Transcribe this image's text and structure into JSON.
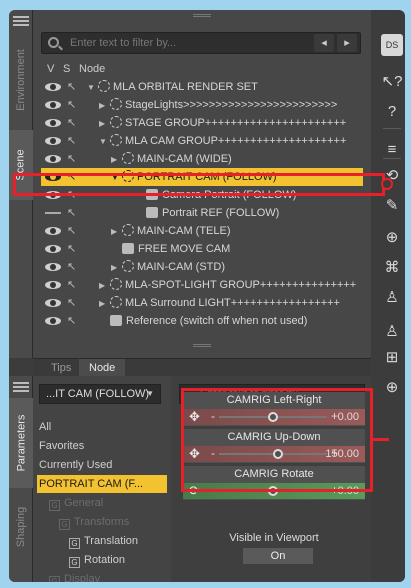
{
  "scene_panel": {
    "vertical_tabs": [
      {
        "label": "Environment",
        "active": false
      },
      {
        "label": "Scene",
        "active": true
      }
    ],
    "search": {
      "placeholder": "Enter text to filter by..."
    },
    "nav": {
      "prev": "◂",
      "next": "▸"
    },
    "columns": {
      "v": "V",
      "s": "S",
      "node": "Node"
    },
    "rows": [
      {
        "label": "MLA ORBITAL RENDER SET",
        "indent": 0,
        "twist": "▼",
        "icon": "node",
        "eye": "on",
        "selected": false
      },
      {
        "label": "StageLights>>>>>>>>>>>>>>>>>>>>>>>>",
        "indent": 1,
        "twist": "▶",
        "icon": "node",
        "eye": "on",
        "selected": false
      },
      {
        "label": "STAGE GROUP++++++++++++++++++++++",
        "indent": 1,
        "twist": "▶",
        "icon": "node",
        "eye": "on",
        "selected": false
      },
      {
        "label": "MLA CAM GROUP++++++++++++++++++++",
        "indent": 1,
        "twist": "▼",
        "icon": "node",
        "eye": "on",
        "selected": false
      },
      {
        "label": "MAIN-CAM (WIDE)",
        "indent": 2,
        "twist": "▶",
        "icon": "node",
        "eye": "on",
        "selected": false
      },
      {
        "label": "PORTRAIT CAM (FOLLOW)",
        "indent": 2,
        "twist": "▼",
        "icon": "node",
        "eye": "on",
        "selected": true
      },
      {
        "label": "Camera Portrait (FOLLOW)",
        "indent": 4,
        "twist": "",
        "icon": "cam",
        "eye": "on",
        "selected": false
      },
      {
        "label": "Portrait REF (FOLLOW)",
        "indent": 4,
        "twist": "",
        "icon": "cam",
        "eye": "off",
        "selected": false
      },
      {
        "label": "MAIN-CAM (TELE)",
        "indent": 2,
        "twist": "▶",
        "icon": "node",
        "eye": "on",
        "selected": false
      },
      {
        "label": "FREE MOVE CAM",
        "indent": 2,
        "twist": "",
        "icon": "cam",
        "eye": "on",
        "selected": false
      },
      {
        "label": "MAIN-CAM (STD)",
        "indent": 2,
        "twist": "▶",
        "icon": "node",
        "eye": "on",
        "selected": false
      },
      {
        "label": "MLA-SPOT-LIGHT GROUP+++++++++++++++",
        "indent": 1,
        "twist": "▶",
        "icon": "node",
        "eye": "on",
        "selected": false
      },
      {
        "label": "MLA Surround LIGHT+++++++++++++++++",
        "indent": 1,
        "twist": "▶",
        "icon": "node",
        "eye": "on",
        "selected": false
      },
      {
        "label": "Reference (switch off when not used)",
        "indent": 1,
        "twist": "",
        "icon": "cam",
        "eye": "on",
        "selected": false
      }
    ],
    "bottom_tabs": [
      {
        "label": "Tips",
        "active": false
      },
      {
        "label": "Node",
        "active": true
      }
    ]
  },
  "right_toolbar": [
    {
      "icon": "daz-studio-icon",
      "glyph": "DS"
    },
    {
      "icon": "whats-this-icon",
      "glyph": "↖?"
    },
    {
      "icon": "help-icon",
      "glyph": "?"
    },
    {
      "icon": "align-icon",
      "glyph": "≡"
    },
    {
      "icon": "transform-tool-icon",
      "glyph": "⟲"
    },
    {
      "icon": "pose-tool-icon",
      "glyph": "✎"
    },
    {
      "icon": "node-selection-icon",
      "glyph": "⊕"
    },
    {
      "icon": "joint-editor-icon",
      "glyph": "⌘"
    },
    {
      "icon": "figure-icon",
      "glyph": "♙"
    },
    {
      "icon": "figure-alt-icon",
      "glyph": "♙"
    },
    {
      "icon": "region-icon",
      "glyph": "⊞"
    },
    {
      "icon": "globe-icon",
      "glyph": "⊕"
    }
  ],
  "parameters_panel": {
    "vertical_tabs": [
      {
        "label": "Parameters",
        "active": true
      },
      {
        "label": "Shaping",
        "active": false
      }
    ],
    "node_selector": "...IT CAM (FOLLOW)",
    "search": {
      "placeholder": "Enter text to filter by..."
    },
    "tree": [
      {
        "label": "All",
        "indent": 0,
        "state": "normal"
      },
      {
        "label": "Favorites",
        "indent": 0,
        "state": "normal"
      },
      {
        "label": "Currently Used",
        "indent": 0,
        "state": "normal"
      },
      {
        "label": "PORTRAIT CAM (F...",
        "indent": 0,
        "state": "selected"
      },
      {
        "label": "General",
        "indent": 1,
        "state": "dim"
      },
      {
        "label": "Transforms",
        "indent": 2,
        "state": "dim"
      },
      {
        "label": "Translation",
        "indent": 3,
        "state": "normal"
      },
      {
        "label": "Rotation",
        "indent": 3,
        "state": "normal"
      },
      {
        "label": "Display",
        "indent": 1,
        "state": "dim"
      }
    ],
    "params": [
      {
        "name": "CAMRIG Left-Right",
        "value": "0.00",
        "level": 0.5,
        "color": "red"
      },
      {
        "name": "CAMRIG Up-Down",
        "value": "150.00",
        "level": 0.55,
        "color": "red"
      },
      {
        "name": "CAMRIG Rotate",
        "value": "0.00",
        "level": 0.5,
        "color": "green"
      }
    ],
    "visible_in_viewport": {
      "label": "Visible in Viewport",
      "value": "On"
    }
  }
}
